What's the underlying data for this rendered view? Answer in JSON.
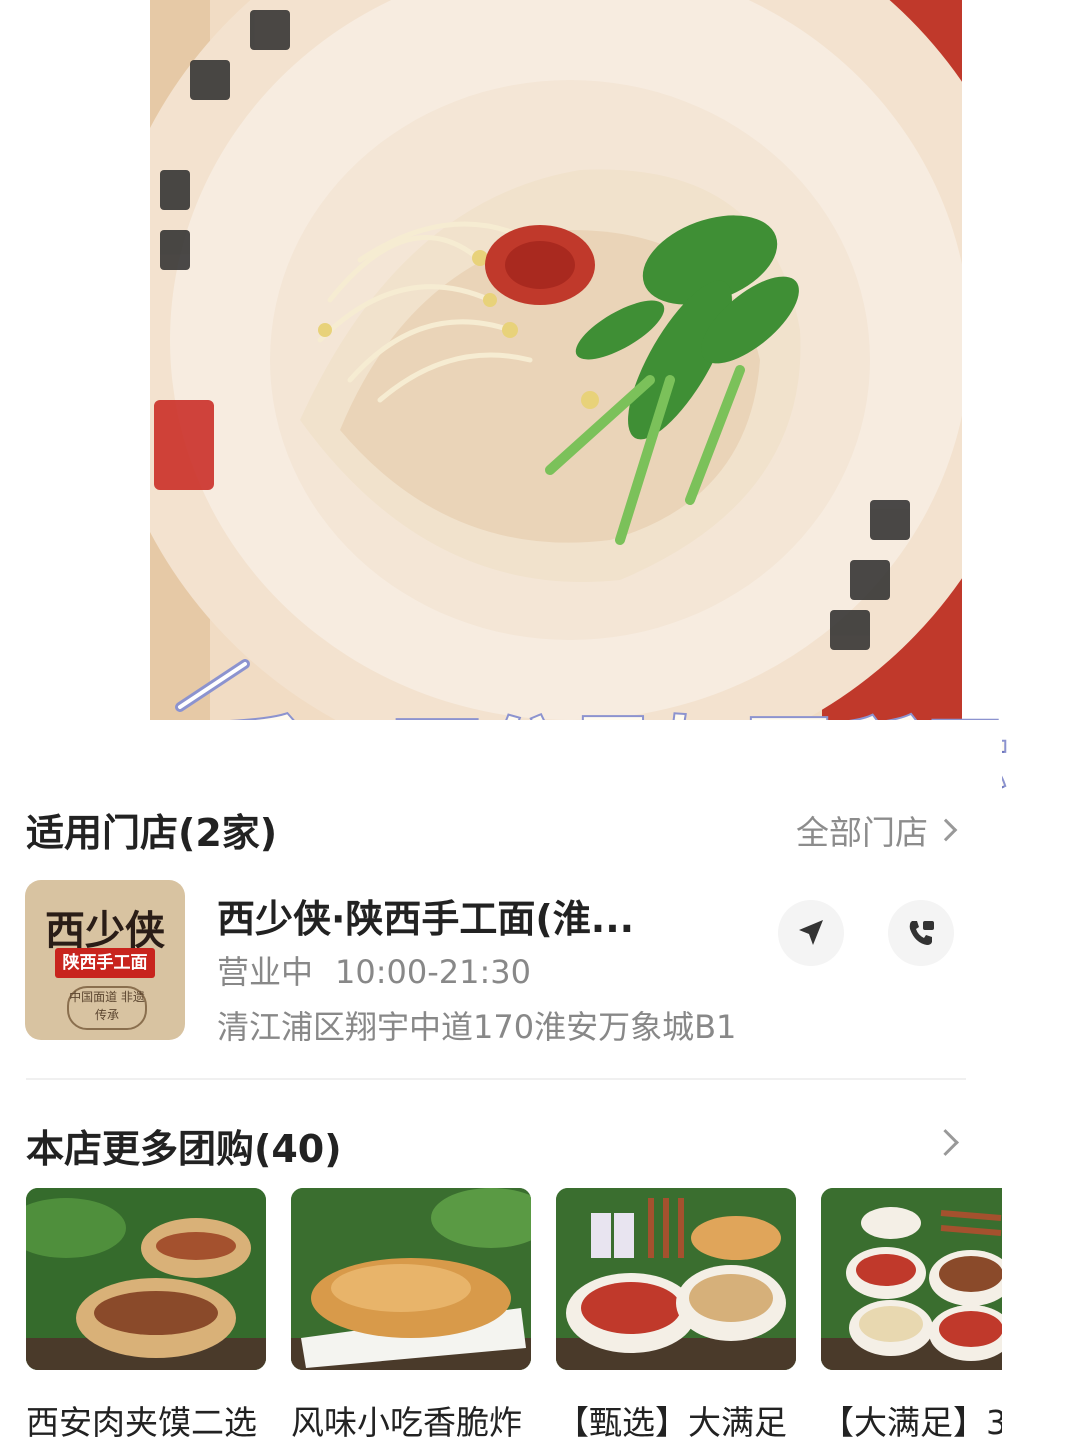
{
  "hero": {
    "caption": "手工面分量如图所示"
  },
  "stores": {
    "title": "适用门店(2家)",
    "all_link": "全部门店",
    "store": {
      "logo_main": "西少侠",
      "logo_sub": "陕西手工面",
      "logo_seal": "中国面道 非遗传承",
      "name": "西少侠·陕西手工面(淮...",
      "status": "营业中",
      "hours": "10:00-21:30",
      "address": "清江浦区翔宇中道170淮安万象城B1"
    }
  },
  "more_deals": {
    "title": "本店更多团购(40)",
    "items": [
      {
        "title": "西安肉夹馍二选"
      },
      {
        "title": "风味小吃香脆炸"
      },
      {
        "title": "【甄选】大满足"
      },
      {
        "title": "【大满足】3"
      }
    ]
  },
  "icons": {
    "navigate": "navigation-arrow-icon",
    "call": "phone-icon",
    "chevron": "chevron-right-icon"
  },
  "colors": {
    "caption_stroke": "#8c93cf",
    "muted_text": "#888888",
    "brand_red": "#c8241d"
  }
}
